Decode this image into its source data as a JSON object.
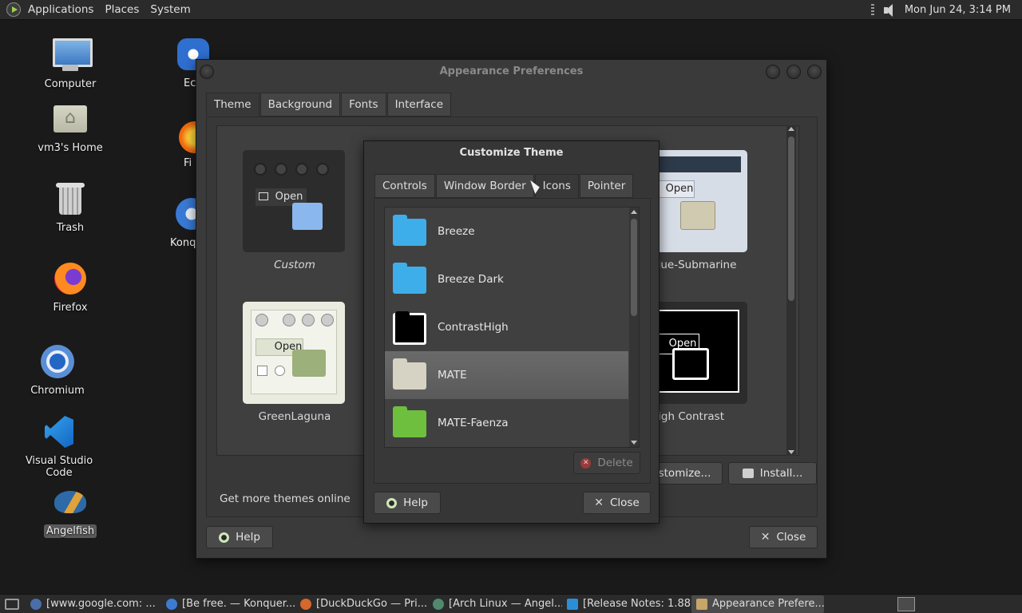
{
  "top_panel": {
    "menus": [
      "Applications",
      "Places",
      "System"
    ],
    "clock": "Mon Jun 24,  3:14 PM"
  },
  "desktop": {
    "icons": [
      {
        "label": "Computer",
        "icon": "monitor-icon"
      },
      {
        "label": "vm3's Home",
        "icon": "home-folder-icon"
      },
      {
        "label": "Trash",
        "icon": "trash-icon"
      },
      {
        "label": "Firefox",
        "icon": "firefox-icon"
      },
      {
        "label": "Chromium",
        "icon": "chromium-icon"
      },
      {
        "label": "Visual Studio Code",
        "icon": "vscode-icon"
      },
      {
        "label": "Angelfish",
        "icon": "angelfish-icon"
      }
    ],
    "partial_labels": [
      "Ec",
      "Fi",
      "Konq"
    ]
  },
  "appearance": {
    "title": "Appearance Preferences",
    "tabs": [
      "Theme",
      "Background",
      "Fonts",
      "Interface"
    ],
    "active_tab": "Theme",
    "themes": [
      "Custom",
      "GreenLaguna",
      "lue-Submarine",
      "High Contrast"
    ],
    "preview_open_label": "Open",
    "get_more": "Get more themes online",
    "customize_label": "stomize...",
    "install_label": "Install...",
    "help_label": "Help",
    "close_label": "Close"
  },
  "customize": {
    "title": "Customize Theme",
    "tabs": [
      "Controls",
      "Window Border",
      "Icons",
      "Pointer"
    ],
    "active_tab": "Icons",
    "icon_themes": [
      {
        "label": "Breeze",
        "color": "#3daee9"
      },
      {
        "label": "Breeze Dark",
        "color": "#3daee9"
      },
      {
        "label": "ContrastHigh",
        "color": "#000000"
      },
      {
        "label": "MATE",
        "color": "#d6d3c4"
      },
      {
        "label": "MATE-Faenza",
        "color": "#6fbf3f"
      }
    ],
    "selected_icon_theme": "MATE",
    "delete_label": "Delete",
    "help_label": "Help",
    "close_label": "Close"
  },
  "taskbar": {
    "tasks": [
      {
        "label": "[www.google.com: ...",
        "color": "#4a6ea8"
      },
      {
        "label": "[Be free. — Konquer...",
        "color": "#3d7bd1"
      },
      {
        "label": "[DuckDuckGo — Pri...",
        "color": "#d5682c"
      },
      {
        "label": "[Arch Linux — Angel...",
        "color": "#4f8a6e"
      },
      {
        "label": "[Release Notes: 1.88....",
        "color": "#2b8fd8"
      },
      {
        "label": "Appearance Prefere...",
        "color": "#c9a56a"
      }
    ],
    "active_task": "Appearance Prefere..."
  }
}
